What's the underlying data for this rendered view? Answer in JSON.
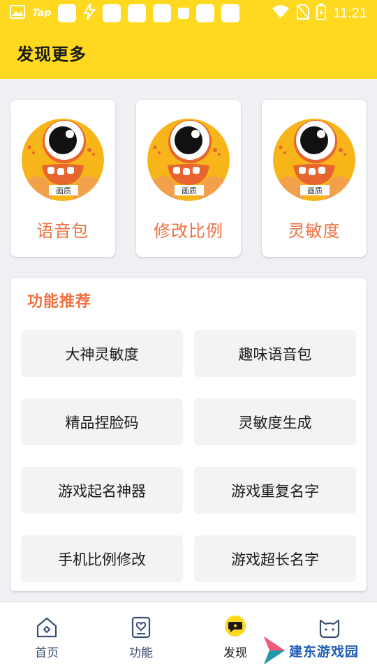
{
  "status_bar": {
    "tap_label": "Tap",
    "time": "11:21"
  },
  "app_bar": {
    "title": "发现更多"
  },
  "cards": [
    {
      "label": "语音包",
      "badge": "画质"
    },
    {
      "label": "修改比例",
      "badge": "画质"
    },
    {
      "label": "灵敏度",
      "badge": "画质"
    }
  ],
  "recommend": {
    "title": "功能推荐",
    "items": [
      "大神灵敏度",
      "趣味语音包",
      "精品捏脸码",
      "灵敏度生成",
      "游戏起名神器",
      "游戏重复名字",
      "手机比例修改",
      "游戏超长名字"
    ]
  },
  "bottom_nav": {
    "items": [
      {
        "label": "首页",
        "icon": "home-icon"
      },
      {
        "label": "功能",
        "icon": "heart-card-icon"
      },
      {
        "label": "发现",
        "icon": "chat-bubble-icon"
      },
      {
        "label": "",
        "icon": "cat-icon"
      }
    ]
  },
  "watermark": {
    "text": "建东游戏园"
  },
  "colors": {
    "brand_yellow": "#ffd91f",
    "accent_orange": "#f0703f",
    "nav_text": "#3a4f73"
  }
}
